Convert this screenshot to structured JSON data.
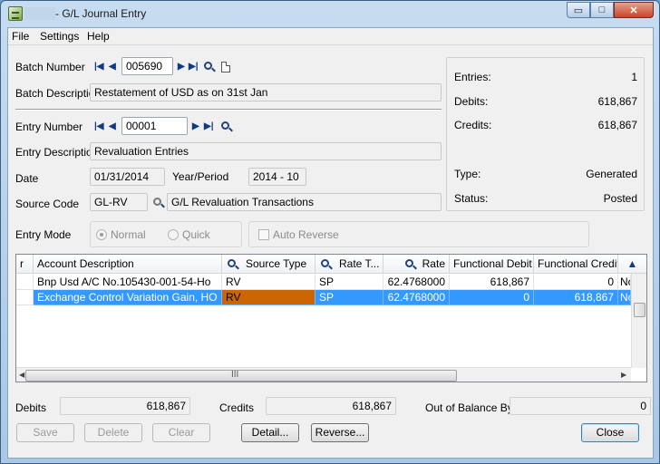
{
  "window": {
    "title": "- G/L Journal Entry",
    "min_glyph": "▭",
    "max_glyph": "□",
    "close_glyph": "✕"
  },
  "menu": [
    "File",
    "Settings",
    "Help"
  ],
  "batch": {
    "number_label": "Batch Number",
    "number": "005690",
    "description_label": "Batch Description",
    "description": "Restatement of USD as on 31st Jan"
  },
  "entry": {
    "number_label": "Entry Number",
    "number": "00001",
    "description_label": "Entry Description",
    "description": "Revaluation Entries",
    "date_label": "Date",
    "date": "01/31/2014",
    "period_label": "Year/Period",
    "period": "2014 - 10",
    "source_label": "Source Code",
    "source_code": "GL-RV",
    "source_desc": "G/L Revaluation Transactions",
    "mode_label": "Entry Mode",
    "mode_normal": "Normal",
    "mode_quick": "Quick",
    "auto_reverse": "Auto Reverse"
  },
  "summary": {
    "entries_label": "Entries:",
    "entries": "1",
    "debits_label": "Debits:",
    "debits": "618,867",
    "credits_label": "Credits:",
    "credits": "618,867",
    "type_label": "Type:",
    "type": "Generated",
    "status_label": "Status:",
    "status": "Posted"
  },
  "grid": {
    "columns": [
      "r",
      "Account Description",
      "Source Type",
      "Rate T...",
      "Rate",
      "Functional Debit",
      "Functional Credit",
      ""
    ],
    "rows": [
      {
        "account": "Bnp Usd A/C No.105430-001-54-Ho",
        "source": "RV",
        "rate_type": "SP",
        "rate": "62.4768000",
        "debit": "618,867",
        "credit": "0",
        "extra": "No"
      },
      {
        "account": "Exchange Control Variation Gain, HO",
        "source": "RV",
        "rate_type": "SP",
        "rate": "62.4768000",
        "debit": "0",
        "credit": "618,867",
        "extra": "No"
      }
    ],
    "hscroll_grip": "III"
  },
  "totals": {
    "debits_label": "Debits",
    "debits": "618,867",
    "credits_label": "Credits",
    "credits": "618,867",
    "oob_label": "Out of Balance By",
    "oob": "0"
  },
  "buttons": {
    "save": "Save",
    "delete": "Delete",
    "clear": "Clear",
    "detail": "Detail...",
    "reverse": "Reverse...",
    "close": "Close"
  }
}
